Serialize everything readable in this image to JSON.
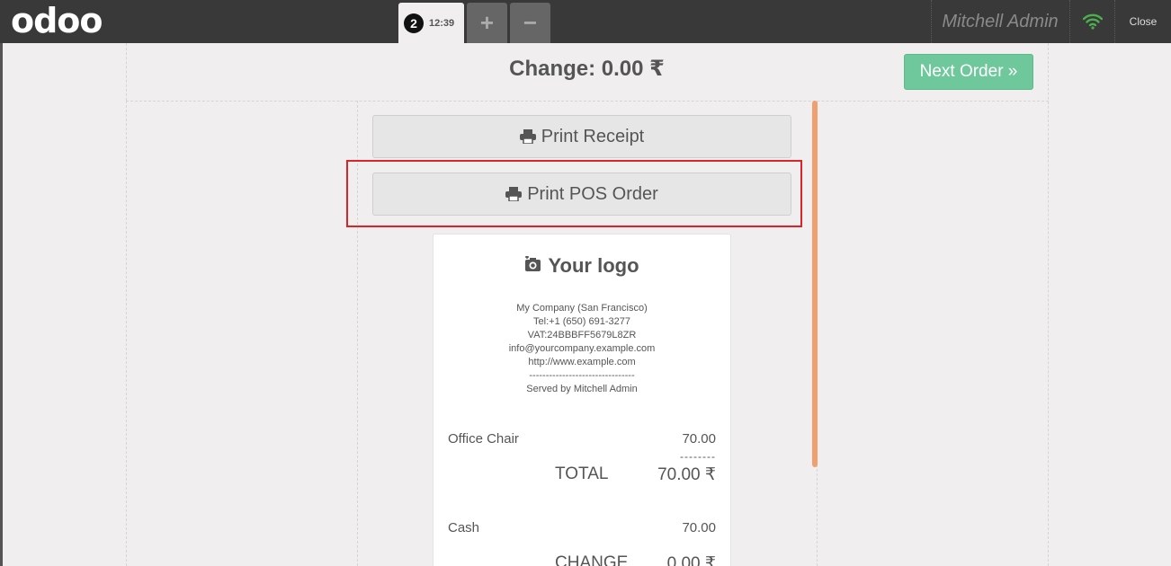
{
  "topbar": {
    "brand": "odoo",
    "order_tab": {
      "number": "2",
      "time": "12:39"
    },
    "add_label": "+",
    "remove_label": "−",
    "user": "Mitchell Admin",
    "close_label": "Close"
  },
  "header": {
    "change_text": "Change: 0.00 ₹",
    "next_order_label": "Next Order »"
  },
  "actions": {
    "print_receipt_label": "Print Receipt",
    "print_pos_label": "Print POS Order"
  },
  "receipt": {
    "logo_text": "Your logo",
    "company": "My Company (San Francisco)",
    "phone": "Tel:+1 (650) 691-3277",
    "vat": "VAT:24BBBFF5679L8ZR",
    "email": "info@yourcompany.example.com",
    "website": "http://www.example.com",
    "divider": "--------------------------------",
    "served_by": "Served by Mitchell Admin",
    "lines": [
      {
        "name": "Office Chair",
        "price": "70.00"
      }
    ],
    "subtotal_dashes": "--------",
    "total_label": "TOTAL",
    "total_value": "70.00 ₹",
    "payment_label": "Cash",
    "payment_value": "70.00",
    "change_label": "CHANGE",
    "change_value": "0.00 ₹"
  },
  "colors": {
    "topbar": "#393939",
    "next_order": "#6ec89b",
    "highlight": "#d9252a",
    "scrollbar": "#f0a070",
    "wifi": "#4caf50"
  }
}
